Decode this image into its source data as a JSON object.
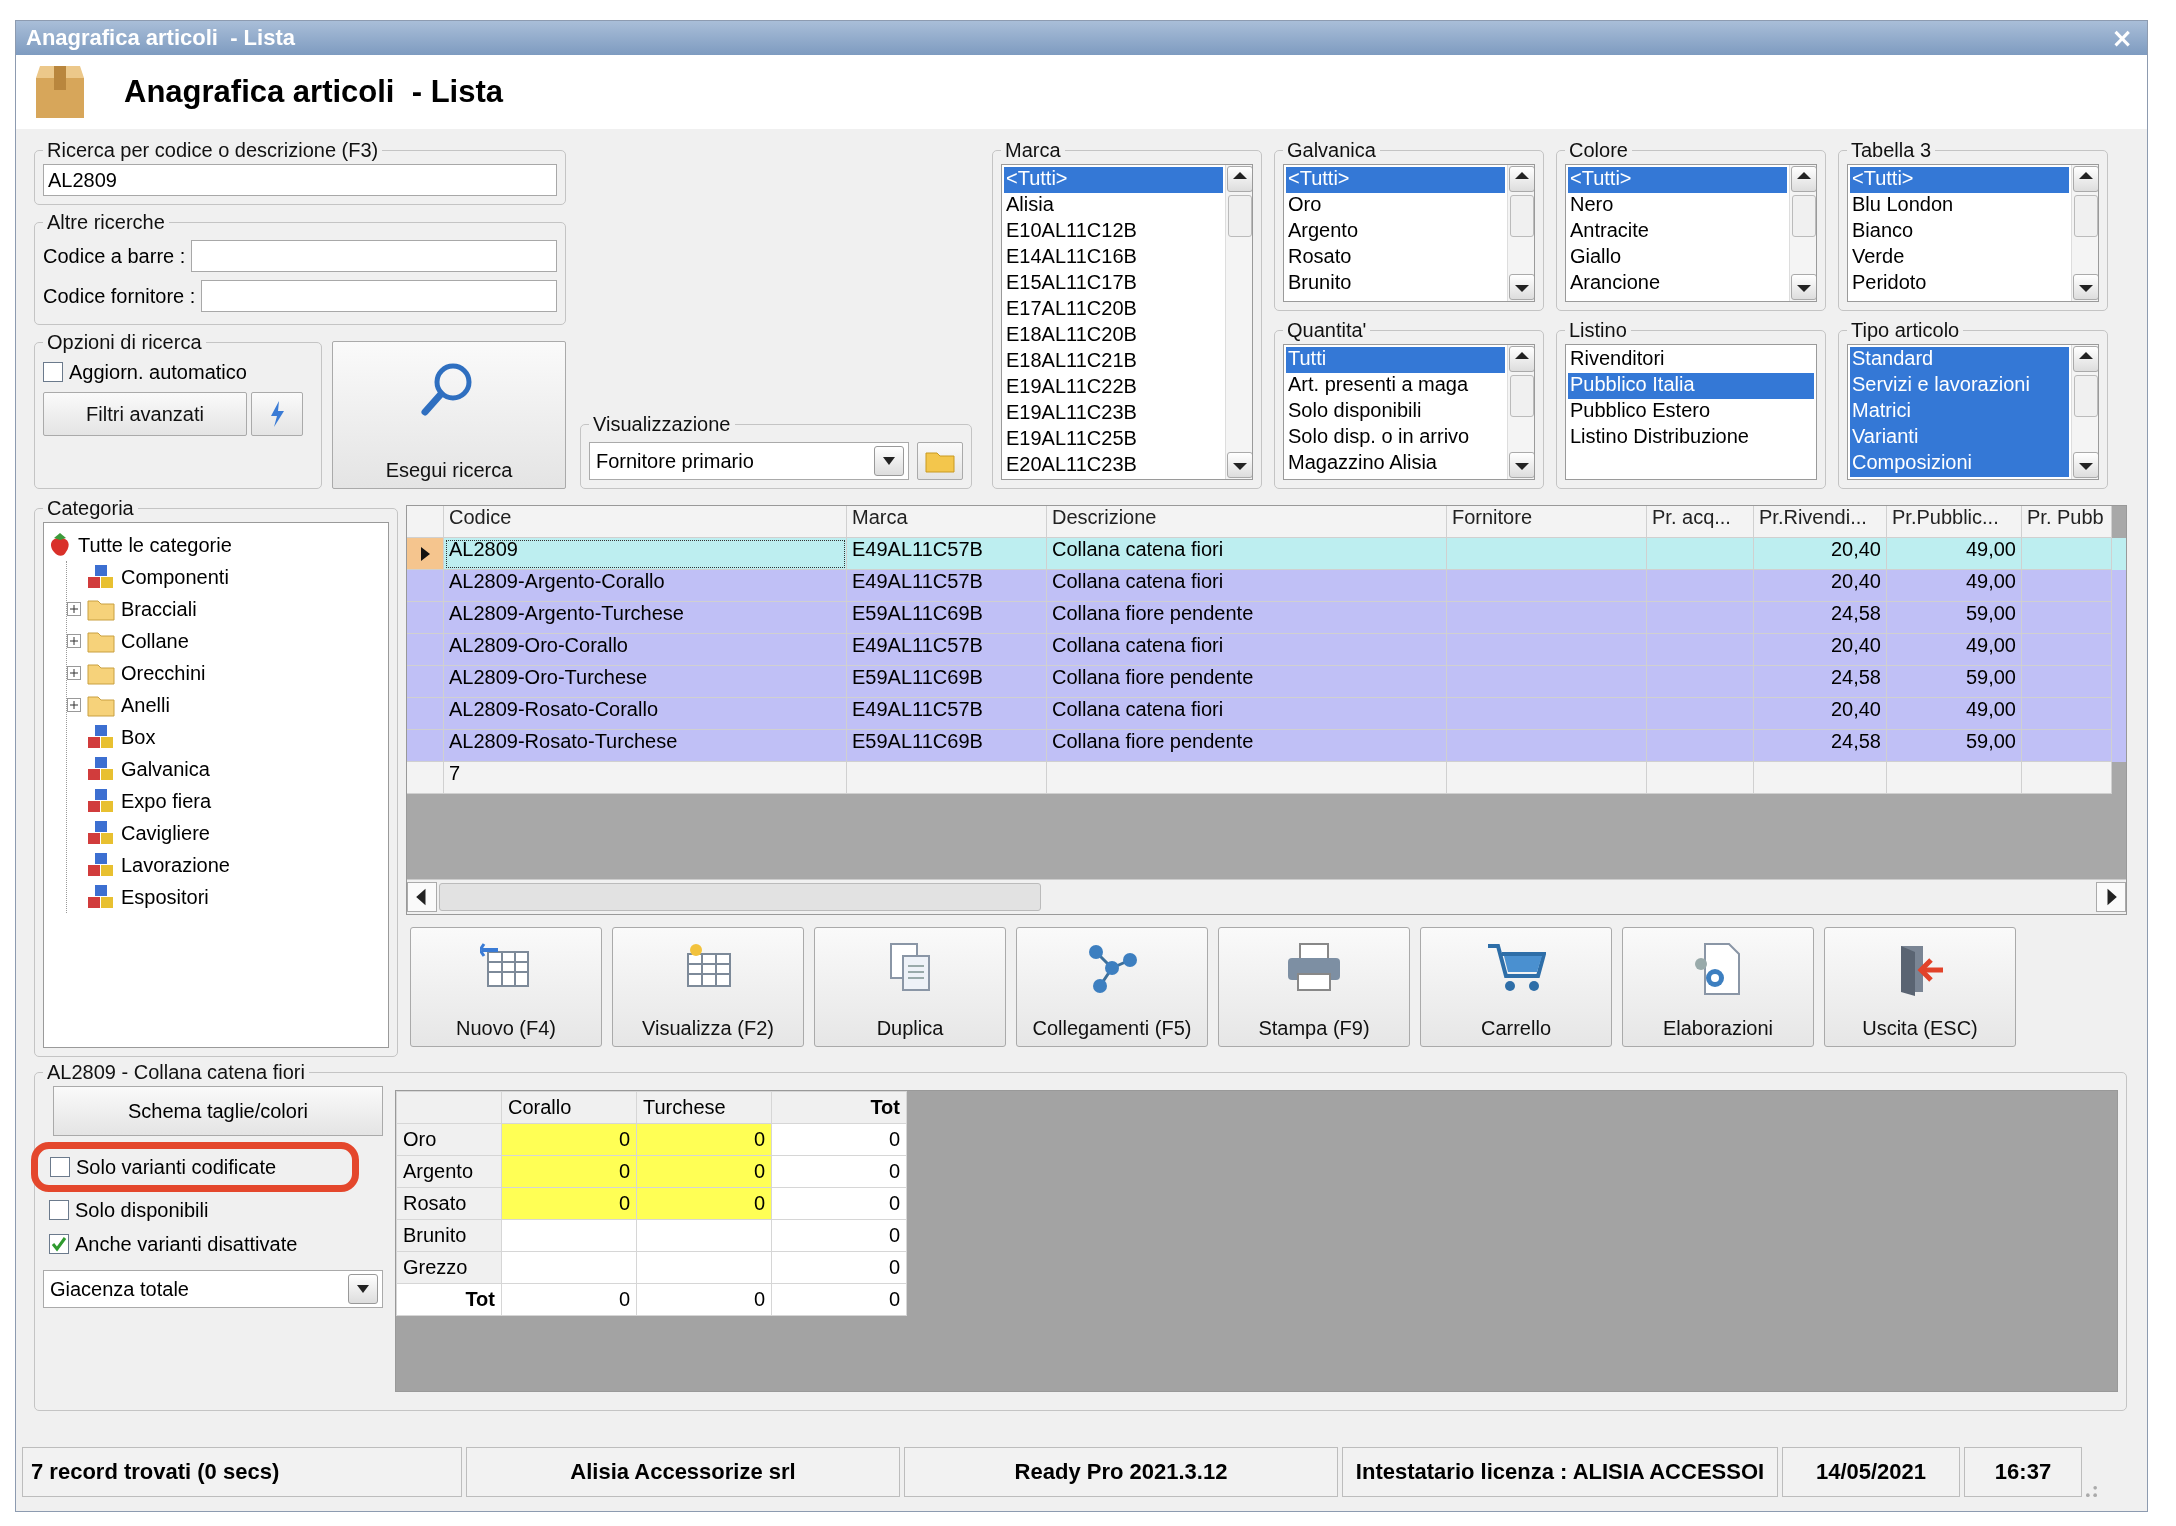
{
  "window": {
    "title": "Anagrafica articoli  - Lista",
    "close": "×"
  },
  "header": {
    "title": "Anagrafica articoli  - Lista"
  },
  "search": {
    "label": "Ricerca per codice o descrizione (F3)",
    "value": "AL2809"
  },
  "other_searches": {
    "label": "Altre ricerche",
    "fields": [
      {
        "label": "Codice a barre :"
      },
      {
        "label": "Codice fornitore :"
      }
    ]
  },
  "search_options": {
    "label": "Opzioni di ricerca",
    "auto_update": {
      "label": "Aggiorn. automatico",
      "checked": false
    },
    "advanced_filters": "Filtri avanzati"
  },
  "search_button": "Esegui ricerca",
  "view": {
    "label": "Visualizzazione",
    "value": "Fornitore primario"
  },
  "filters": [
    {
      "title": "Marca",
      "items": [
        {
          "label": "<Tutti>",
          "selected": true
        },
        {
          "label": "Alisia",
          "selected": false
        },
        {
          "label": "E10AL11C12B",
          "selected": false
        },
        {
          "label": "E14AL11C16B",
          "selected": false
        },
        {
          "label": "E15AL11C17B",
          "selected": false
        },
        {
          "label": "E17AL11C20B",
          "selected": false
        },
        {
          "label": "E18AL11C20B",
          "selected": false
        },
        {
          "label": "E18AL11C21B",
          "selected": false
        },
        {
          "label": "E19AL11C22B",
          "selected": false
        },
        {
          "label": "E19AL11C23B",
          "selected": false
        },
        {
          "label": "E19AL11C25B",
          "selected": false
        },
        {
          "label": "E20AL11C23B",
          "selected": false
        }
      ]
    },
    {
      "title": "Galvanica",
      "items": [
        {
          "label": "<Tutti>",
          "selected": true
        },
        {
          "label": "Oro",
          "selected": false
        },
        {
          "label": "Argento",
          "selected": false
        },
        {
          "label": "Rosato",
          "selected": false
        },
        {
          "label": "Brunito",
          "selected": false
        }
      ]
    },
    {
      "title": "Colore",
      "items": [
        {
          "label": "<Tutti>",
          "selected": true
        },
        {
          "label": "Nero",
          "selected": false
        },
        {
          "label": "Antracite",
          "selected": false
        },
        {
          "label": "Giallo",
          "selected": false
        },
        {
          "label": "Arancione",
          "selected": false
        }
      ]
    },
    {
      "title": "Tabella 3",
      "items": [
        {
          "label": "<Tutti>",
          "selected": true
        },
        {
          "label": "Blu London",
          "selected": false
        },
        {
          "label": "Bianco",
          "selected": false
        },
        {
          "label": "Verde",
          "selected": false
        },
        {
          "label": "Peridoto",
          "selected": false
        }
      ]
    },
    {
      "title": "Quantita'",
      "items": [
        {
          "label": "Tutti",
          "selected": true
        },
        {
          "label": "Art. presenti a maga",
          "selected": false
        },
        {
          "label": "Solo disponibili",
          "selected": false
        },
        {
          "label": "Solo disp. o in arrivo",
          "selected": false
        },
        {
          "label": "Magazzino Alisia",
          "selected": false
        }
      ]
    },
    {
      "title": "Listino",
      "items": [
        {
          "label": "Rivenditori",
          "selected": false
        },
        {
          "label": "Pubblico Italia",
          "selected": true
        },
        {
          "label": "Pubblico Estero",
          "selected": false
        },
        {
          "label": "Listino Distribuzione",
          "selected": false
        }
      ]
    },
    {
      "title": "Tipo articolo",
      "items": [
        {
          "label": "Standard",
          "selected": true
        },
        {
          "label": "Servizi e lavorazioni",
          "selected": true
        },
        {
          "label": "Matrici",
          "selected": true
        },
        {
          "label": "Varianti",
          "selected": true
        },
        {
          "label": "Composizioni",
          "selected": true
        }
      ]
    }
  ],
  "categories": {
    "label": "Categoria",
    "tree": {
      "label": "Tutte le categorie",
      "children": [
        {
          "label": "Componenti"
        },
        {
          "label": "Bracciali",
          "expanded": false
        },
        {
          "label": "Collane",
          "expanded": false
        },
        {
          "label": "Orecchini",
          "expanded": false
        },
        {
          "label": "Anelli",
          "expanded": false
        },
        {
          "label": "Box"
        },
        {
          "label": "Galvanica"
        },
        {
          "label": "Expo fiera"
        },
        {
          "label": "Cavigliere"
        },
        {
          "label": "Lavorazione"
        },
        {
          "label": "Espositori"
        }
      ]
    }
  },
  "grid": {
    "columns": [
      "Codice",
      "Marca",
      "Descrizione",
      "Fornitore",
      "Pr. acq...",
      "Pr.Rivendi...",
      "Pr.Pubblic...",
      "Pr. Pubb"
    ],
    "rows": [
      {
        "selected": true,
        "cells": [
          "AL2809",
          "E49AL11C57B",
          "Collana catena fiori",
          null,
          null,
          "20,40",
          "49,00",
          null
        ]
      },
      {
        "selected": false,
        "cells": [
          "AL2809-Argento-Corallo",
          "E49AL11C57B",
          "Collana catena fiori",
          null,
          null,
          "20,40",
          "49,00",
          null
        ]
      },
      {
        "selected": false,
        "cells": [
          "AL2809-Argento-Turchese",
          "E59AL11C69B",
          "Collana fiore pendente",
          null,
          null,
          "24,58",
          "59,00",
          null
        ]
      },
      {
        "selected": false,
        "cells": [
          "AL2809-Oro-Corallo",
          "E49AL11C57B",
          "Collana catena fiori",
          null,
          null,
          "20,40",
          "49,00",
          null
        ]
      },
      {
        "selected": false,
        "cells": [
          "AL2809-Oro-Turchese",
          "E59AL11C69B",
          "Collana fiore pendente",
          null,
          null,
          "24,58",
          "59,00",
          null
        ]
      },
      {
        "selected": false,
        "cells": [
          "AL2809-Rosato-Corallo",
          "E49AL11C57B",
          "Collana catena fiori",
          null,
          null,
          "20,40",
          "49,00",
          null
        ]
      },
      {
        "selected": false,
        "cells": [
          "AL2809-Rosato-Turchese",
          "E59AL11C69B",
          "Collana fiore pendente",
          null,
          null,
          "24,58",
          "59,00",
          null
        ]
      }
    ],
    "record_count": "7"
  },
  "toolbar": [
    "Nuovo (F4)",
    "Visualizza (F2)",
    "Duplica",
    "Collegamenti (F5)",
    "Stampa (F9)",
    "Carrello",
    "Elaborazioni",
    "Uscita (ESC)"
  ],
  "variants": {
    "title": "AL2809 - Collana catena fiori",
    "schema_button": "Schema taglie/colori",
    "checkboxes": [
      {
        "label": "Solo varianti codificate",
        "checked": false,
        "highlighted": true
      },
      {
        "label": "Solo disponibili",
        "checked": false,
        "highlighted": false
      },
      {
        "label": "Anche varianti disattivate",
        "checked": true,
        "highlighted": false
      }
    ],
    "stock_select": "Giacenza totale",
    "matrix": {
      "columns": [
        "Corallo",
        "Turchese",
        "Tot"
      ],
      "rows": [
        {
          "label": "Oro",
          "kind": "row",
          "cells": [
            {
              "value": "0",
              "highlighted": true
            },
            {
              "value": "0",
              "highlighted": true
            },
            {
              "value": "0",
              "highlighted": false
            }
          ]
        },
        {
          "label": "Argento",
          "kind": "row",
          "cells": [
            {
              "value": "0",
              "highlighted": true
            },
            {
              "value": "0",
              "highlighted": true
            },
            {
              "value": "0",
              "highlighted": false
            }
          ]
        },
        {
          "label": "Rosato",
          "kind": "row",
          "cells": [
            {
              "value": "0",
              "highlighted": true
            },
            {
              "value": "0",
              "highlighted": true
            },
            {
              "value": "0",
              "highlighted": false
            }
          ]
        },
        {
          "label": "Brunito",
          "kind": "row",
          "cells": [
            {
              "highlighted": false
            },
            {
              "highlighted": false
            },
            {
              "value": "0",
              "highlighted": false
            }
          ]
        },
        {
          "label": "Grezzo",
          "kind": "row",
          "cells": [
            {
              "highlighted": false
            },
            {
              "highlighted": false
            },
            {
              "value": "0",
              "highlighted": false
            }
          ]
        },
        {
          "label": "Tot",
          "kind": "total",
          "cells": [
            {
              "value": "0",
              "highlighted": false
            },
            {
              "value": "0",
              "highlighted": false
            },
            {
              "value": "0",
              "highlighted": false
            }
          ]
        }
      ]
    }
  },
  "status_bar": [
    "7 record trovati (0 secs)",
    "Alisia Accessorize srl",
    "Ready Pro 2021.3.12",
    "Intestatario licenza : ALISIA ACCESSOI",
    "14/05/2021",
    "16:37"
  ]
}
